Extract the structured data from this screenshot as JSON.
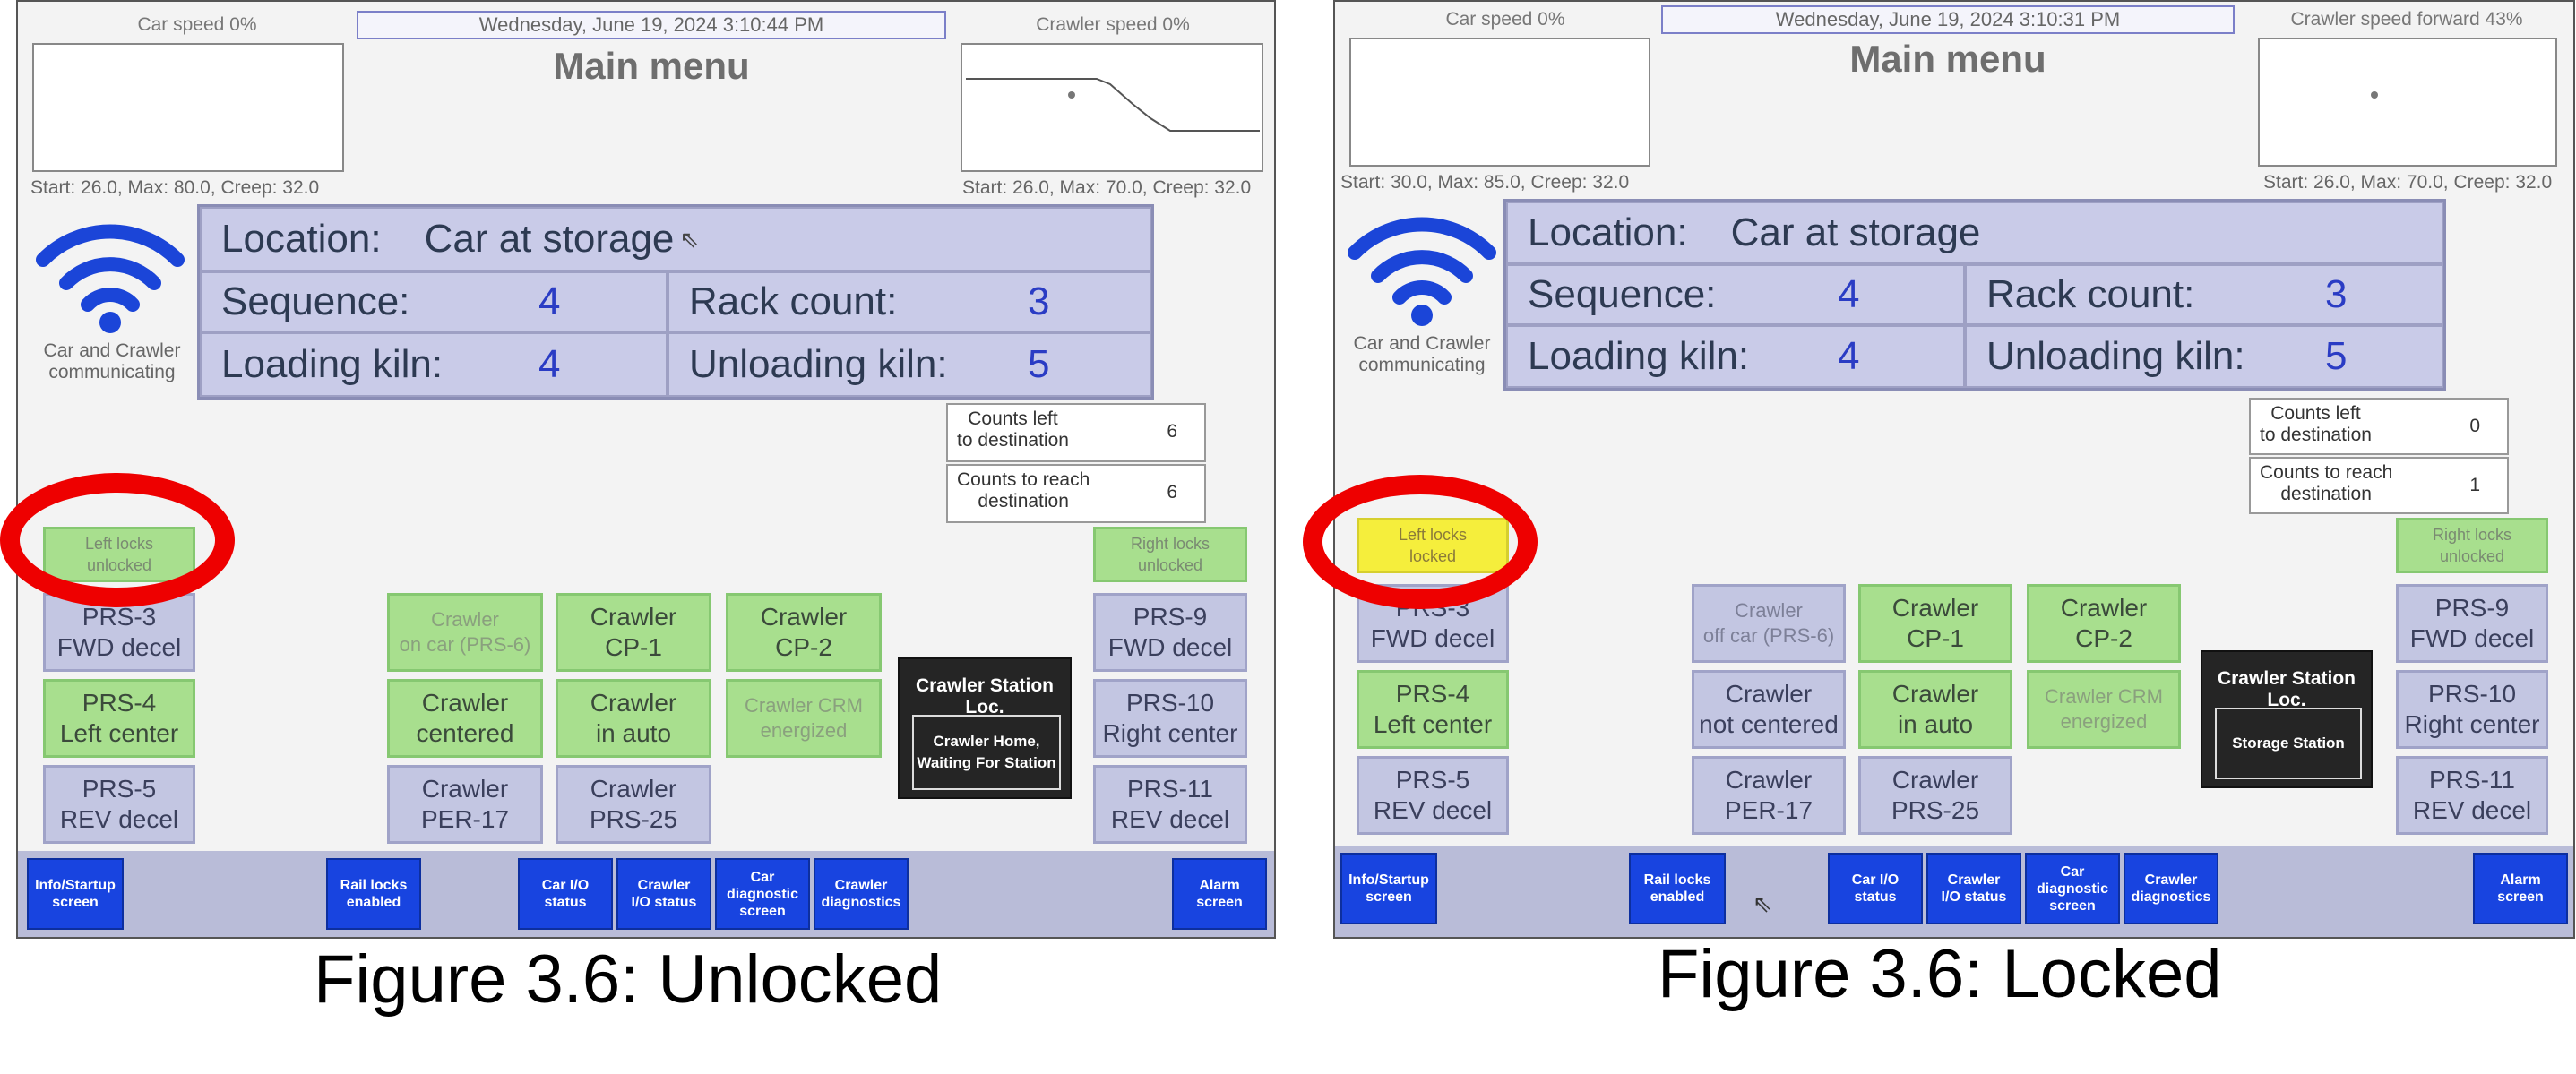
{
  "left": {
    "car_speed_title": "Car speed 0%",
    "crawler_speed_title": "Crawler speed 0%",
    "datetime": "Wednesday, June 19, 2024 3:10:44 PM",
    "menu_title": "Main menu",
    "car_limits": "Start: 26.0, Max: 80.0, Creep: 32.0",
    "crawler_limits": "Start: 26.0, Max: 70.0, Creep: 32.0",
    "comm_label": "Car and Crawler\ncommunicating",
    "location_label": "Location:",
    "location_value": "Car at storage",
    "sequence_label": "Sequence:",
    "sequence_value": "4",
    "rack_label": "Rack count:",
    "rack_value": "3",
    "loading_label": "Loading kiln:",
    "loading_value": "4",
    "unloading_label": "Unloading kiln:",
    "unloading_value": "5",
    "counts_left_label": "Counts left\nto destination",
    "counts_left_value": "6",
    "counts_reach_label": "Counts to reach\ndestination",
    "counts_reach_value": "6",
    "left_locks": "Left locks\nunlocked",
    "right_locks": "Right locks\nunlocked",
    "prs3": "PRS-3\nFWD decel",
    "prs4": "PRS-4\nLeft center",
    "prs5": "PRS-5\nREV decel",
    "prs9": "PRS-9\nFWD decel",
    "prs10": "PRS-10\nRight center",
    "prs11": "PRS-11\nREV decel",
    "crawler_on_car": "Crawler\non car (PRS-6)",
    "crawler_cp1": "Crawler\nCP-1",
    "crawler_cp2": "Crawler\nCP-2",
    "crawler_centered": "Crawler\ncentered",
    "crawler_auto": "Crawler\nin auto",
    "crawler_crm": "Crawler CRM\nenergized",
    "crawler_per17": "Crawler\nPER-17",
    "crawler_prs25": "Crawler\nPRS-25",
    "station_title": "Crawler Station Loc.",
    "station_value": "Crawler Home,\nWaiting For Station",
    "nav_info": "Info/Startup\nscreen",
    "nav_rail": "Rail locks\nenabled",
    "nav_car_io": "Car I/O\nstatus",
    "nav_crawler_io": "Crawler\nI/O status",
    "nav_car_diag": "Car\ndiagnostic\nscreen",
    "nav_crawler_diag": "Crawler\ndiagnostics",
    "nav_alarm": "Alarm\nscreen",
    "caption": "Figure 3.6: Unlocked"
  },
  "right": {
    "car_speed_title": "Car speed 0%",
    "crawler_speed_title": "Crawler speed forward 43%",
    "datetime": "Wednesday, June 19, 2024 3:10:31 PM",
    "menu_title": "Main menu",
    "car_limits": "Start: 30.0, Max: 85.0, Creep: 32.0",
    "crawler_limits": "Start: 26.0, Max: 70.0, Creep: 32.0",
    "comm_label": "Car and Crawler\ncommunicating",
    "location_label": "Location:",
    "location_value": "Car at storage",
    "sequence_label": "Sequence:",
    "sequence_value": "4",
    "rack_label": "Rack count:",
    "rack_value": "3",
    "loading_label": "Loading kiln:",
    "loading_value": "4",
    "unloading_label": "Unloading kiln:",
    "unloading_value": "5",
    "counts_left_label": "Counts left\nto destination",
    "counts_left_value": "0",
    "counts_reach_label": "Counts to reach\ndestination",
    "counts_reach_value": "1",
    "left_locks": "Left locks\nlocked",
    "right_locks": "Right locks\nunlocked",
    "prs3": "PRS-3\nFWD decel",
    "prs4": "PRS-4\nLeft center",
    "prs5": "PRS-5\nREV decel",
    "prs9": "PRS-9\nFWD decel",
    "prs10": "PRS-10\nRight center",
    "prs11": "PRS-11\nREV decel",
    "crawler_on_car": "Crawler\noff car (PRS-6)",
    "crawler_cp1": "Crawler\nCP-1",
    "crawler_cp2": "Crawler\nCP-2",
    "crawler_centered": "Crawler\nnot centered",
    "crawler_auto": "Crawler\nin auto",
    "crawler_crm": "Crawler CRM\nenergized",
    "crawler_per17": "Crawler\nPER-17",
    "crawler_prs25": "Crawler\nPRS-25",
    "station_title": "Crawler Station Loc.",
    "station_value": "Storage Station",
    "nav_info": "Info/Startup\nscreen",
    "nav_rail": "Rail locks\nenabled",
    "nav_car_io": "Car I/O\nstatus",
    "nav_crawler_io": "Crawler\nI/O status",
    "nav_car_diag": "Car\ndiagnostic\nscreen",
    "nav_crawler_diag": "Crawler\ndiagnostics",
    "nav_alarm": "Alarm\nscreen",
    "caption": "Figure 3.6: Locked"
  },
  "colors": {
    "green_indicator": "#a8df8e",
    "grey_indicator": "#c3c6e2",
    "yellow_indicator": "#f5ee3c",
    "nav_blue": "#1844e0",
    "highlight_ring": "#ee0000",
    "wifi_blue": "#1b45d8"
  },
  "icons": {
    "wifi": "wifi-icon",
    "cursor": "cursor-icon"
  }
}
